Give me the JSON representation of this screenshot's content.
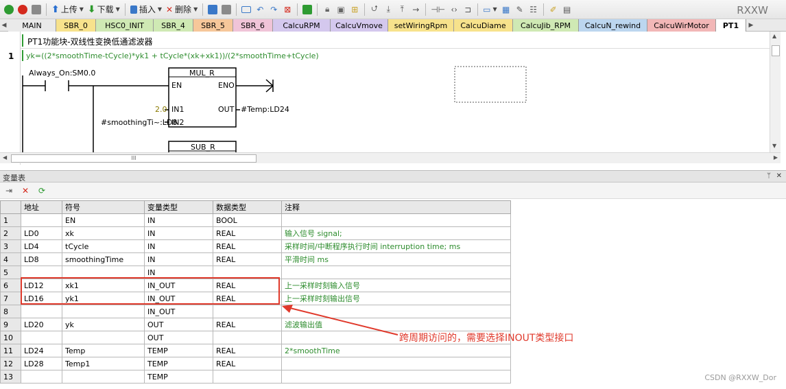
{
  "toolbar": {
    "upload_label": "上传",
    "download_label": "下载",
    "insert_label": "插入",
    "delete_label": "删除",
    "brand": "RXXW"
  },
  "tabs": [
    {
      "label": "MAIN",
      "color": "#eaeaea"
    },
    {
      "label": "SBR_0",
      "color": "#f7e28c"
    },
    {
      "label": "HSC0_INIT",
      "color": "#cfe9b4"
    },
    {
      "label": "SBR_4",
      "color": "#cfe9b4"
    },
    {
      "label": "SBR_5",
      "color": "#f6c79a"
    },
    {
      "label": "SBR_6",
      "color": "#f0c4d8"
    },
    {
      "label": "CalcuRPM",
      "color": "#d4c8ee"
    },
    {
      "label": "CalcuVmove",
      "color": "#d4c8ee"
    },
    {
      "label": "setWiringRpm",
      "color": "#f7e28c"
    },
    {
      "label": "CalcuDiame",
      "color": "#f7e28c"
    },
    {
      "label": "CalcuJib_RPM",
      "color": "#cfe9b4"
    },
    {
      "label": "CalcuN_rewind",
      "color": "#bcd6ef"
    },
    {
      "label": "CalcuWirMotor",
      "color": "#f2b7b7"
    },
    {
      "label": "PT1",
      "color": "#ffffff"
    }
  ],
  "editor": {
    "block_title": "PT1功能块-双线性变换低通滤波器",
    "network_number": "1",
    "network_comment": "yk=((2*smoothTime-tCycle)*yk1 + tCycle*(xk+xk1))/(2*smoothTime+tCycle)",
    "contact_label": "Always_On:SM0.0",
    "mul_title": "MUL_R",
    "sub_title": "SUB_R",
    "pin_en": "EN",
    "pin_eno": "ENO",
    "pin_in1": "IN1",
    "pin_in2": "IN2",
    "pin_out": "OUT",
    "in1_value": "2.0",
    "in2_value": "#smoothingTi~:LD8",
    "out_value": "#Temp:LD24",
    "hscroll_grip": "III"
  },
  "variables": {
    "panel_title": "变量表",
    "columns": [
      "地址",
      "符号",
      "变量类型",
      "数据类型",
      "注释"
    ],
    "rows": [
      {
        "n": "1",
        "addr": "",
        "sym": "EN",
        "var": "IN",
        "dtype": "BOOL",
        "cmt": ""
      },
      {
        "n": "2",
        "addr": "LD0",
        "sym": "xk",
        "var": "IN",
        "dtype": "REAL",
        "cmt": "输入信号 signal;"
      },
      {
        "n": "3",
        "addr": "LD4",
        "sym": "tCycle",
        "var": "IN",
        "dtype": "REAL",
        "cmt": "采样时间/中断程序执行时间 interruption time; ms"
      },
      {
        "n": "4",
        "addr": "LD8",
        "sym": "smoothingTime",
        "var": "IN",
        "dtype": "REAL",
        "cmt": "平滑时间 ms"
      },
      {
        "n": "5",
        "addr": "",
        "sym": "",
        "var": "IN",
        "dtype": "",
        "cmt": ""
      },
      {
        "n": "6",
        "addr": "LD12",
        "sym": "xk1",
        "var": "IN_OUT",
        "dtype": "REAL",
        "cmt": "上一采样时刻输入信号"
      },
      {
        "n": "7",
        "addr": "LD16",
        "sym": "yk1",
        "var": "IN_OUT",
        "dtype": "REAL",
        "cmt": "上一采样时刻输出信号"
      },
      {
        "n": "8",
        "addr": "",
        "sym": "",
        "var": "IN_OUT",
        "dtype": "",
        "cmt": ""
      },
      {
        "n": "9",
        "addr": "LD20",
        "sym": "yk",
        "var": "OUT",
        "dtype": "REAL",
        "cmt": "滤波输出值"
      },
      {
        "n": "10",
        "addr": "",
        "sym": "",
        "var": "OUT",
        "dtype": "",
        "cmt": ""
      },
      {
        "n": "11",
        "addr": "LD24",
        "sym": "Temp",
        "var": "TEMP",
        "dtype": "REAL",
        "cmt": "2*smoothTime"
      },
      {
        "n": "12",
        "addr": "LD28",
        "sym": "Temp1",
        "var": "TEMP",
        "dtype": "REAL",
        "cmt": ""
      },
      {
        "n": "13",
        "addr": "",
        "sym": "",
        "var": "TEMP",
        "dtype": "",
        "cmt": ""
      }
    ]
  },
  "annotation": "跨周期访问的，需要选择INOUT类型接口",
  "watermark": "CSDN @RXXW_Dor",
  "colors": {
    "highlight": "#e0392b",
    "comment_green": "#2d8c2d"
  }
}
